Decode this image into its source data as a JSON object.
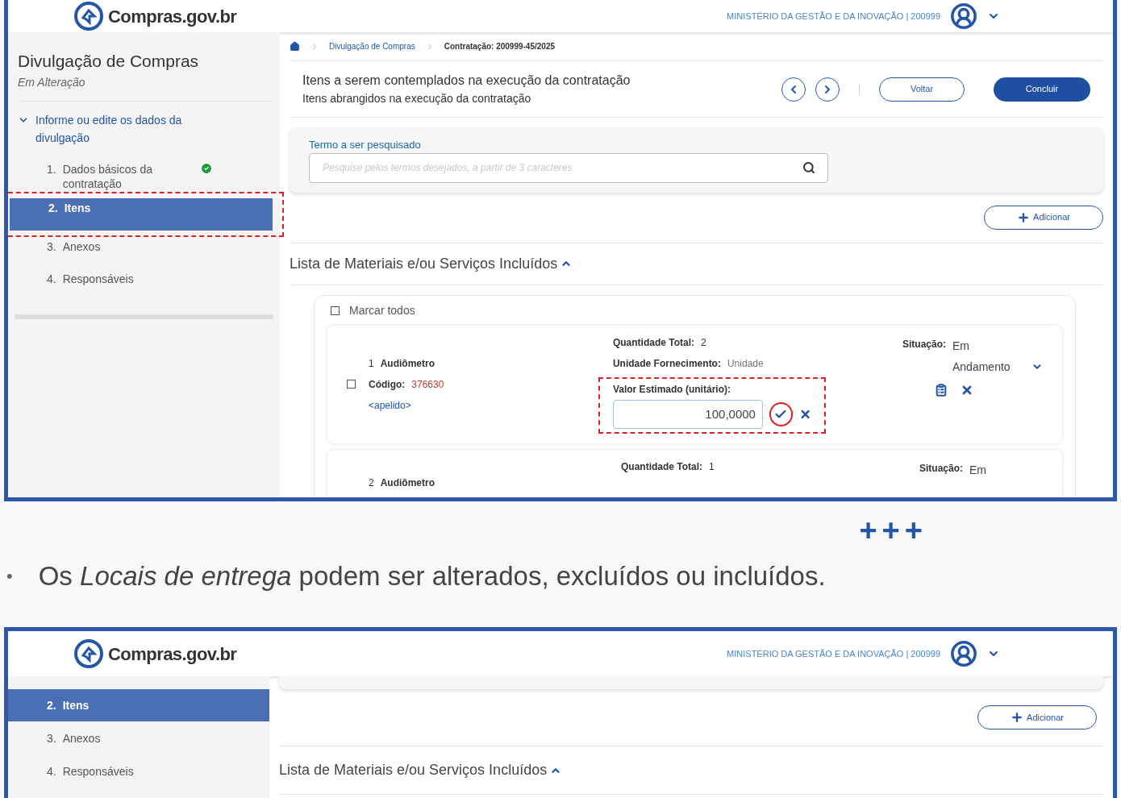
{
  "screenshot_1": {
    "header": {
      "logo_text": "Compras.gov.br",
      "ministry": "MINISTÉRIO DA GESTÃO E DA INOVAÇÃO | 200999"
    },
    "sidebar": {
      "title": "Divulgação de Compras",
      "subtitle": "Em Alteração",
      "section": {
        "label": "Informe ou edite os dados da divulgação",
        "expanded": true
      },
      "steps": [
        {
          "number": "1.",
          "label": "Dados básicos da contratação",
          "done": true,
          "selected": false,
          "highlighted": false
        },
        {
          "number": "2.",
          "label": "Itens",
          "done": false,
          "selected": true,
          "highlighted": true
        },
        {
          "number": "3.",
          "label": "Anexos",
          "done": false,
          "selected": false,
          "highlighted": false
        },
        {
          "number": "4.",
          "label": "Responsáveis",
          "done": false,
          "selected": false,
          "highlighted": false
        }
      ]
    },
    "breadcrumb": [
      "Divulgação de Compras",
      "Contratação: 200999-45/2025"
    ],
    "page_title": "Itens a serem contemplados na execução da contratação",
    "page_subtitle": "Itens abrangidos na execução da contratação",
    "back_button": "Voltar",
    "finish_button": "Concluir",
    "search": {
      "label": "Termo a ser pesquisado",
      "placeholder": "Pesquise pelos termos desejados, a partir de 3 caracteres"
    },
    "add_button": "Adicionar",
    "list_title": "Lista de Materiais e/ou Serviços Incluídos",
    "select_all": {
      "label": "Marcar todos",
      "checked": false
    },
    "items": [
      {
        "number": "1",
        "name": "Audiômetro",
        "checked": false,
        "code_label": "Código:",
        "code": "376630",
        "alias": "<apelido>",
        "quantity_label": "Quantidade Total:",
        "quantity": "2",
        "unit_label": "Unidade Fornecimento:",
        "unit": "Unidade",
        "value_label": "Valor Estimado (unitário):",
        "value": "100,0000",
        "editing": true,
        "status_label": "Situação:",
        "status": "Em Andamento"
      },
      {
        "number": "2",
        "name": "Audiômetro",
        "quantity_label": "Quantidade Total:",
        "quantity": "1",
        "status_label": "Situação:",
        "status": "Em"
      }
    ]
  },
  "separator": "+++",
  "bullet": "•",
  "bullet_text": "Os *Locais de entrega* podem ser alterados, excluídos ou incluídos.",
  "screenshot_2": {
    "header": {
      "logo_text": "Compras.gov.br",
      "ministry": "MINISTÉRIO DA GESTÃO E DA INOVAÇÃO | 200999"
    },
    "steps": [
      {
        "number": "2.",
        "label": "Itens",
        "selected": true
      },
      {
        "number": "3.",
        "label": "Anexos",
        "selected": false
      },
      {
        "number": "4.",
        "label": "Responsáveis",
        "selected": false
      }
    ],
    "add_button": "Adicionar",
    "list_title": "Lista de Materiais e/ou Serviços Incluídos"
  }
}
